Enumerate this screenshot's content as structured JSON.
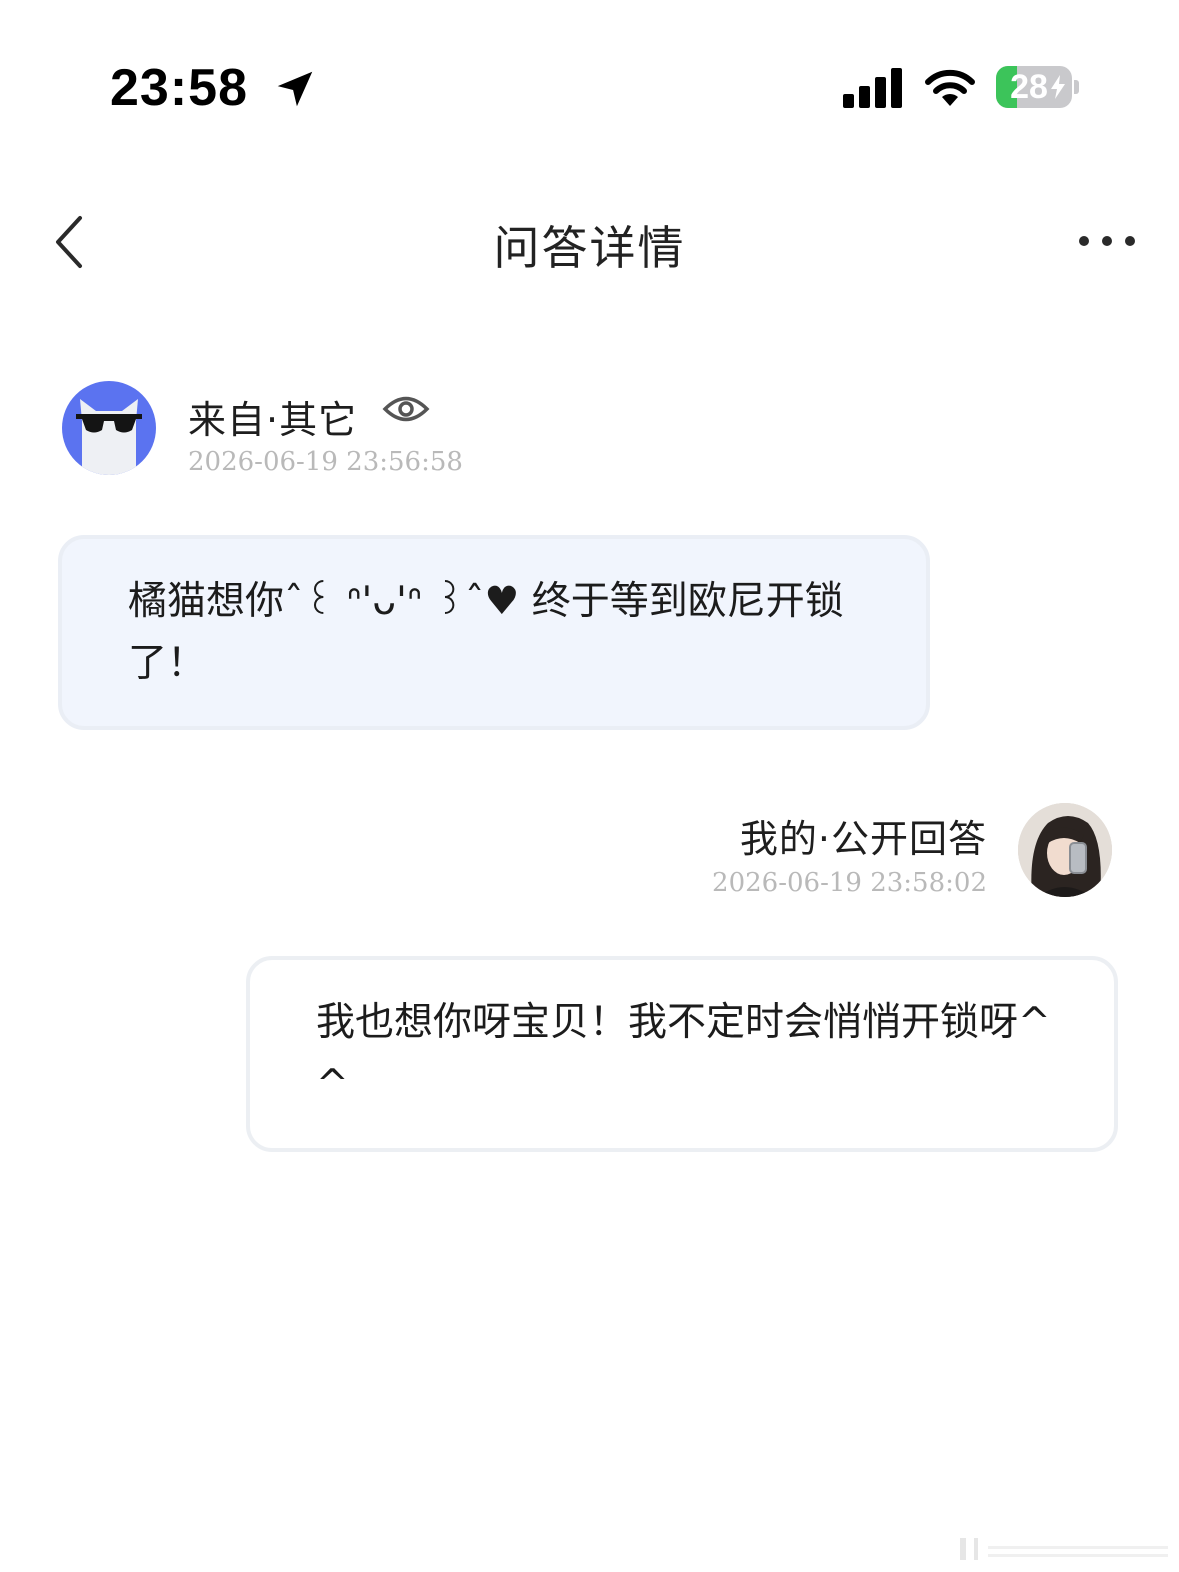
{
  "status_bar": {
    "time": "23:58",
    "battery_level": "28",
    "battery_fraction": 0.28,
    "icons": [
      "location-arrow-icon",
      "cellular-signal-icon",
      "wifi-icon",
      "battery-charging-icon"
    ]
  },
  "nav": {
    "title": "问答详情",
    "back_icon": "chevron-left-icon",
    "more_icon": "more-dots-icon"
  },
  "question": {
    "source_label": "来自·其它",
    "visibility_icon": "eye-icon",
    "timestamp": "2026-06-19 23:56:58",
    "avatar_icon": "cat-with-sunglasses-avatar",
    "text": "橘猫想你ˆ꒰ ᐢ'ᴗ'ᐢ ꒱ˆ♥ 终于等到欧尼开锁了！"
  },
  "answer": {
    "label": "我的·公开回答",
    "timestamp": "2026-06-19 23:58:02",
    "avatar_icon": "user-photo-avatar",
    "text": "我也想你呀宝贝！我不定时会悄悄开锁呀^^"
  },
  "colors": {
    "asker_avatar_bg": "#5b73f0",
    "question_bubble_bg": "#f1f5fd",
    "battery_green": "#3cc45a",
    "timestamp_gray": "#b9b9b9"
  }
}
